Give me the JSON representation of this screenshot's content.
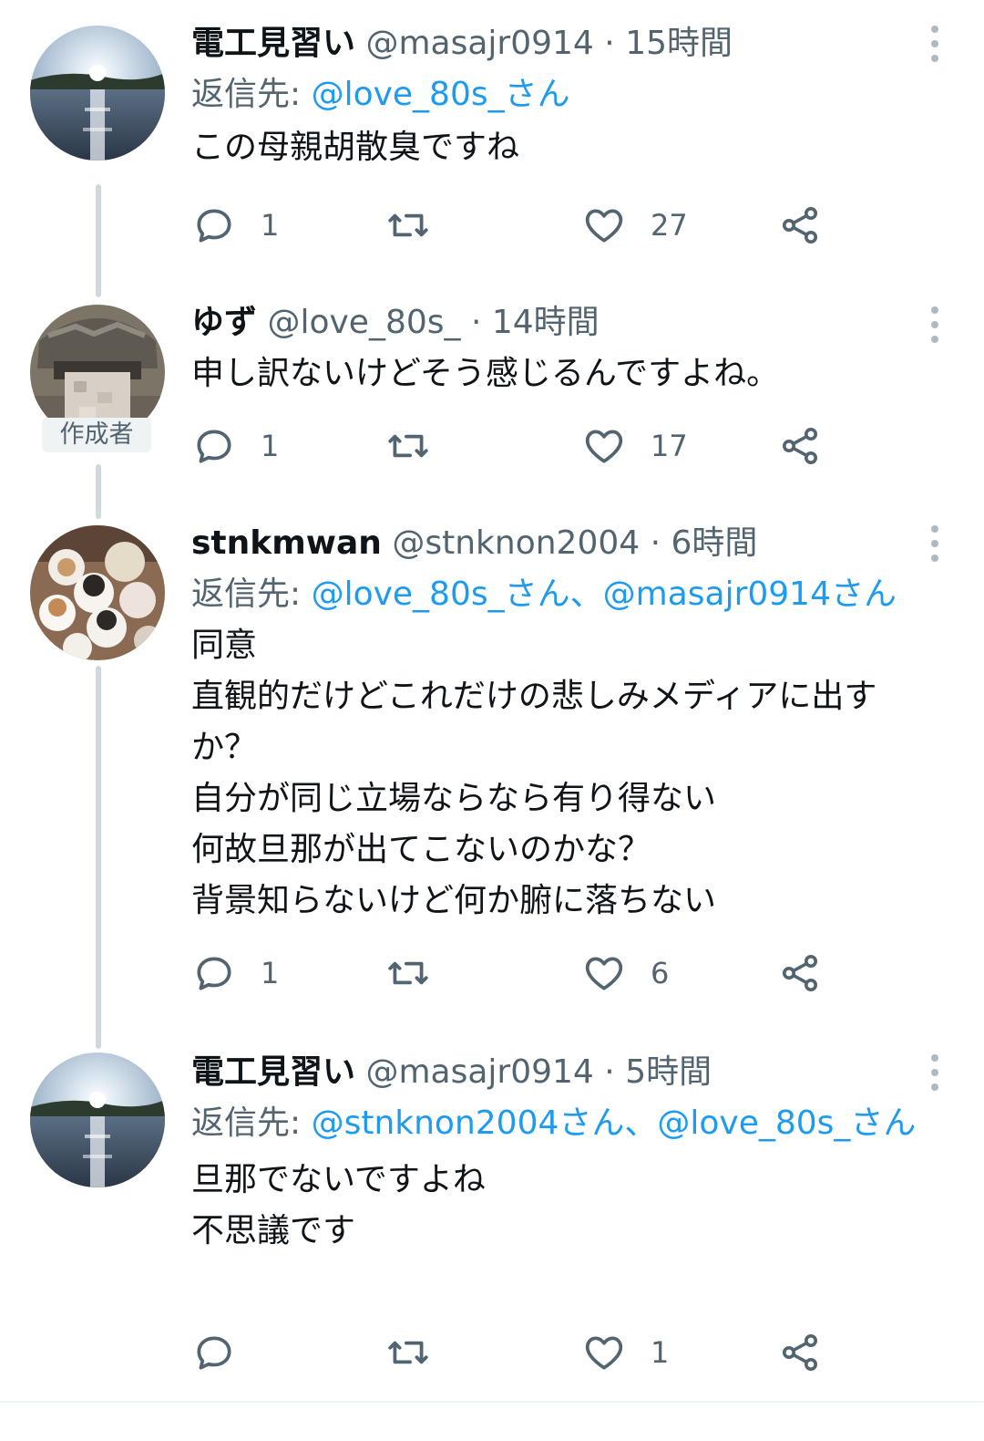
{
  "tweets": [
    {
      "name": "電工見習い",
      "handle": "@masajr0914",
      "separator": "·",
      "time": "15時間",
      "reply_prefix": "返信先: ",
      "reply_mentions": "@love_80s_さん",
      "body": "この母親胡散臭ですね",
      "actions": {
        "reply": "1",
        "retweet": "",
        "like": "27"
      }
    },
    {
      "name": "ゆず",
      "handle": "@love_80s_",
      "separator": "·",
      "time": "14時間",
      "author_badge": "作成者",
      "body": "申し訳ないけどそう感じるんですよね。",
      "actions": {
        "reply": "1",
        "retweet": "",
        "like": "17"
      }
    },
    {
      "name": "stnkmwan",
      "handle": "@stnknon2004",
      "separator": "·",
      "time": "6時間",
      "reply_prefix": "返信先: ",
      "reply_mentions": "@love_80s_さん、@masajr0914さん",
      "body": "同意\n直観的だけどこれだけの悲しみメディアに出すか？\n自分が同じ立場ならなら有り得ない\n何故旦那が出てこないのかな？\n背景知らないけど何か腑に落ちない",
      "actions": {
        "reply": "1",
        "retweet": "",
        "like": "6"
      }
    },
    {
      "name": "電工見習い",
      "handle": "@masajr0914",
      "separator": "·",
      "time": "5時間",
      "reply_prefix": "返信先: ",
      "reply_mentions": "@stnknon2004さん、@love_80s_さん",
      "body": "旦那でないですよね\n不思議です",
      "actions": {
        "reply": "",
        "retweet": "",
        "like": "1"
      }
    }
  ],
  "icons": {
    "reply": "speech-bubble-icon",
    "retweet": "retweet-arrows-icon",
    "like": "heart-outline-icon",
    "share": "share-nodes-icon",
    "more": "vertical-ellipsis-icon"
  },
  "colors": {
    "text": "#0f1419",
    "secondary": "#536471",
    "link": "#1d9bf0",
    "thread_line": "#cfd9de"
  }
}
